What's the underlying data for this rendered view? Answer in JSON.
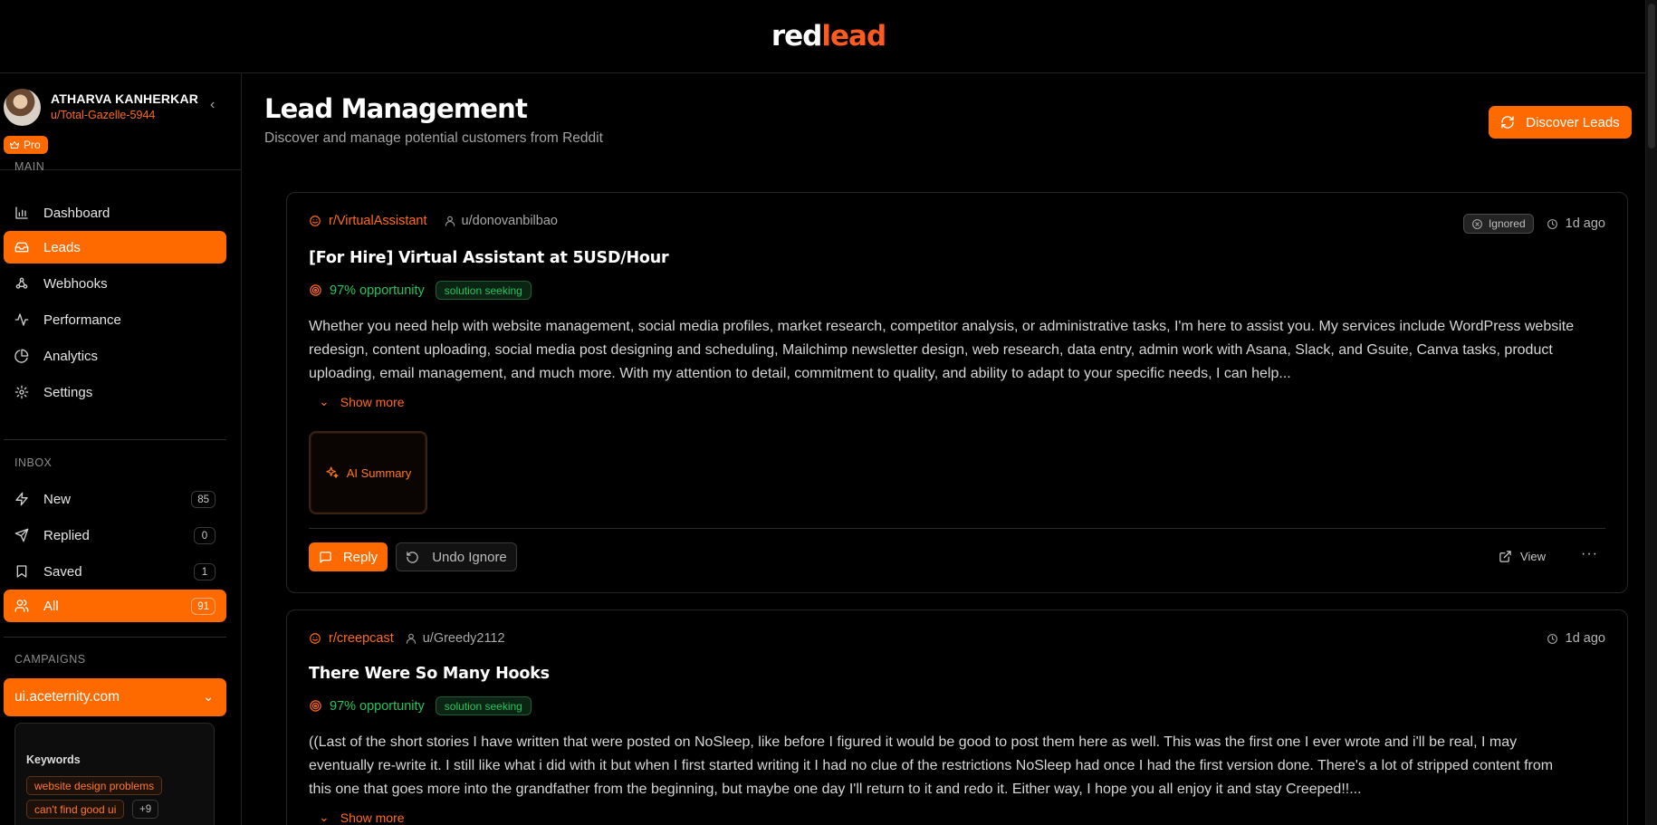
{
  "app": {
    "logo_part1": "red",
    "logo_part2": "lead"
  },
  "profile": {
    "name": "ATHARVA KANHERKAR",
    "handle": "u/Total-Gazelle-5944",
    "plan": "Pro"
  },
  "sidebar": {
    "main_label": "MAIN",
    "main_items": [
      {
        "label": "Dashboard",
        "icon": "bar-chart-icon"
      },
      {
        "label": "Leads",
        "icon": "inbox-icon",
        "active": true
      },
      {
        "label": "Webhooks",
        "icon": "webhook-icon"
      },
      {
        "label": "Performance",
        "icon": "activity-icon"
      },
      {
        "label": "Analytics",
        "icon": "pie-chart-icon"
      },
      {
        "label": "Settings",
        "icon": "gear-icon"
      }
    ],
    "inbox_label": "INBOX",
    "inbox_items": [
      {
        "label": "New",
        "count": "85",
        "icon": "zap-icon"
      },
      {
        "label": "Replied",
        "count": "0",
        "icon": "send-icon"
      },
      {
        "label": "Saved",
        "count": "1",
        "icon": "bookmark-icon"
      },
      {
        "label": "All",
        "count": "91",
        "icon": "users-icon",
        "active": true
      }
    ],
    "campaigns_label": "CAMPAIGNS",
    "campaign": "ui.aceternity.com",
    "keywords_title": "Keywords",
    "keywords": [
      "website design problems",
      "can't find good ui"
    ],
    "keywords_more": "+9"
  },
  "main": {
    "title": "Lead Management",
    "subtitle": "Discover and manage potential customers from Reddit",
    "discover_label": "Discover Leads"
  },
  "leads": [
    {
      "subreddit": "r/VirtualAssistant",
      "author": "u/donovanbilbao",
      "status": "Ignored",
      "time": "1d ago",
      "title": "[For Hire] Virtual Assistant at 5USD/Hour",
      "opportunity": "97% opportunity",
      "tag": "solution seeking",
      "body": "Whether you need help with website management, social media profiles, market research, competitor analysis, or administrative tasks, I'm here to assist you. My services include WordPress website redesign, content uploading, social media post designing and scheduling, Mailchimp newsletter design, web research, data entry, admin work with Asana, Slack, and Gsuite, Canva tasks, product uploading, email management, and much more. With my attention to detail, commitment to quality, and ability to adapt to your specific needs, I can help...",
      "show_more": "Show more",
      "ai_summary": "AI Summary",
      "reply": "Reply",
      "undo": "Undo Ignore",
      "view": "View"
    },
    {
      "subreddit": "r/creepcast",
      "author": "u/Greedy2112",
      "time": "1d ago",
      "title": "There Were So Many Hooks",
      "opportunity": "97% opportunity",
      "tag": "solution seeking",
      "body": "((Last of the short stories I have written that were posted on NoSleep, like before I figured it would be good to post them here as well. This was the first one I ever wrote and i'll be real, I may eventually re-write it. I still like what i did with it but when I first started writing it I had no clue of the restrictions NoSleep had once I had the first version done. There's a lot of stripped content from this one that goes more into the grandfather from the beginning, but maybe one day I'll return to it and redo it. Either way, I hope you all enjoy it and stay Creeped!!...",
      "show_more": "Show more"
    }
  ],
  "colors": {
    "accent": "#ff6a00",
    "success": "#22c55e",
    "background": "#000000"
  }
}
